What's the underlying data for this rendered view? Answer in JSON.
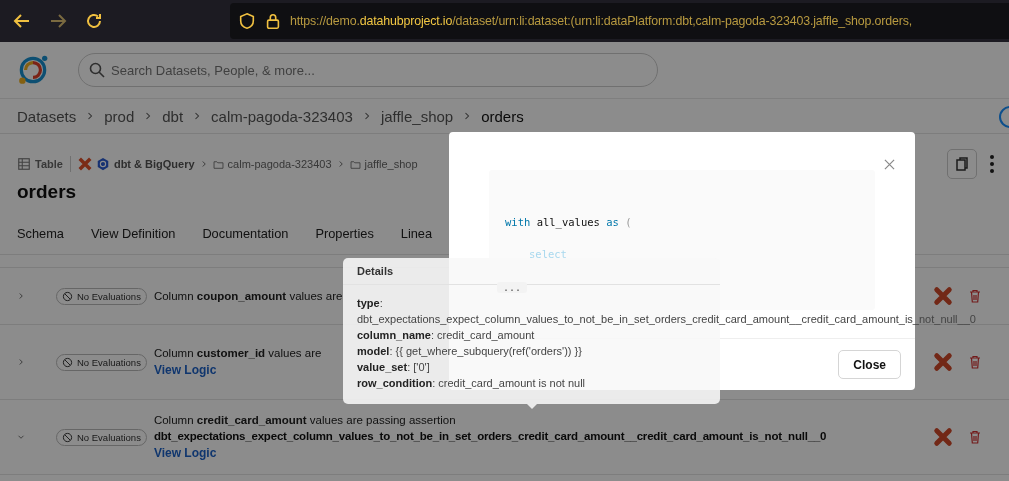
{
  "browser": {
    "url_prefix": "https://demo.",
    "url_domain": "datahubproject.io",
    "url_path": "/dataset/urn:li:dataset:(urn:li:dataPlatform:dbt,calm-pagoda-323403.jaffle_shop.orders,"
  },
  "search": {
    "placeholder": "Search Datasets, People, & more..."
  },
  "breadcrumbs": [
    {
      "label": "Datasets",
      "current": false
    },
    {
      "label": "prod",
      "current": false
    },
    {
      "label": "dbt",
      "current": false
    },
    {
      "label": "calm-pagoda-323403",
      "current": false
    },
    {
      "label": "jaffle_shop",
      "current": false
    },
    {
      "label": "orders",
      "current": true
    }
  ],
  "entity": {
    "type_label": "Table",
    "platform": "dbt & BigQuery",
    "containers": [
      "calm-pagoda-323403",
      "jaffle_shop"
    ],
    "title": "orders"
  },
  "tabs": [
    {
      "label": "Schema",
      "selected": false
    },
    {
      "label": "View Definition",
      "selected": false
    },
    {
      "label": "Documentation",
      "selected": false
    },
    {
      "label": "Properties",
      "selected": false
    },
    {
      "label": "Linea",
      "selected": false
    }
  ],
  "assertions": [
    {
      "expanded": false,
      "status": "No Evaluations",
      "text": "Column **coupon_amount** values are"
    },
    {
      "expanded": false,
      "status": "No Evaluations",
      "text": "Column **customer_id** values are",
      "link": "View Logic"
    },
    {
      "expanded": true,
      "status": "No Evaluations",
      "text": "Column **credit_card_amount** values are passing assertion",
      "name": "dbt_expectations_expect_column_values_to_not_be_in_set_orders_credit_card_amount__credit_card_amount_is_not_null__0",
      "link": "View Logic"
    }
  ],
  "modal": {
    "code": [
      [
        {
          "kind": "keyword",
          "text": "with"
        },
        {
          "kind": "ident",
          "text": "all_values"
        },
        {
          "kind": "keyword",
          "text": "as"
        },
        {
          "kind": "punct",
          "text": "("
        }
      ],
      [
        {
          "kind": "faded",
          "text": "select"
        }
      ]
    ],
    "more": "...",
    "button": "Close"
  },
  "tooltip": {
    "title": "Details",
    "fields": [
      {
        "key": "type",
        "sep": ":",
        "value": "dbt_expectations_expect_column_values_to_not_be_in_set_orders_credit_card_amount__credit_card_amount_is_not_null__0",
        "kind": "block"
      },
      {
        "key": "column_name",
        "sep": ":",
        "value": "credit_card_amount",
        "kind": "inline"
      },
      {
        "key": "model",
        "sep": ":",
        "value": "{{ get_where_subquery(ref('orders')) }}",
        "kind": "inline"
      },
      {
        "key": "value_set",
        "sep": ":",
        "value": "['0']",
        "kind": "inline"
      },
      {
        "key": "row_condition",
        "sep": ":",
        "value": "credit_card_amount is not null",
        "kind": "inline"
      }
    ]
  }
}
